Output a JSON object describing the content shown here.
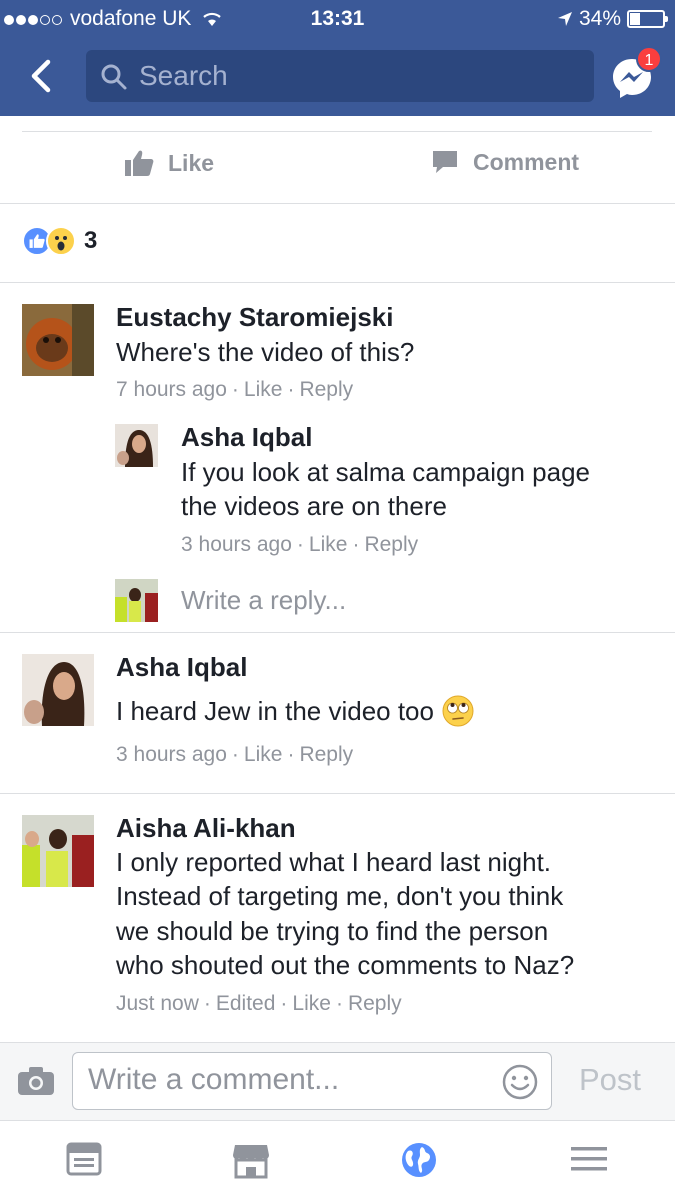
{
  "status_bar": {
    "carrier": "vodafone UK",
    "time": "13:31",
    "battery": "34%"
  },
  "header": {
    "search_placeholder": "Search",
    "messenger_badge": "1"
  },
  "actions": {
    "like": "Like",
    "comment": "Comment"
  },
  "reactions": {
    "count": "3",
    "types": [
      "like",
      "wow"
    ]
  },
  "comments": [
    {
      "name": "Eustachy Staromiejski",
      "text": [
        "Where's the video of this?"
      ],
      "time": "7 hours ago",
      "like": "Like",
      "reply": "Reply"
    },
    {
      "name": "Asha Iqbal",
      "text": [
        "If you look at salma campaign page",
        "the videos are on there"
      ],
      "time": "3 hours ago",
      "like": "Like",
      "reply": "Reply",
      "is_reply": true
    },
    {
      "name": "Asha Iqbal",
      "text": [
        "I heard Jew in the video too"
      ],
      "time": "3 hours ago",
      "like": "Like",
      "reply": "Reply",
      "emoji": "rolling-eyes-emoji"
    },
    {
      "name": "Aisha Ali-khan",
      "text": [
        "I only reported what I heard last night.",
        "Instead of targeting me, don't you think",
        "we should be trying to find the person",
        "who shouted out the comments to Naz?"
      ],
      "time": "Just now",
      "edited": "Edited",
      "like": "Like",
      "reply": "Reply"
    }
  ],
  "write_reply_placeholder": "Write a reply...",
  "composer": {
    "placeholder": "Write a comment...",
    "post": "Post"
  },
  "tabbar": [
    "news-feed-icon",
    "marketplace-icon",
    "globe-icon",
    "menu-icon"
  ],
  "colors": {
    "brand": "#3b5998",
    "meta": "#90949c",
    "badge": "#fa3e3e"
  }
}
